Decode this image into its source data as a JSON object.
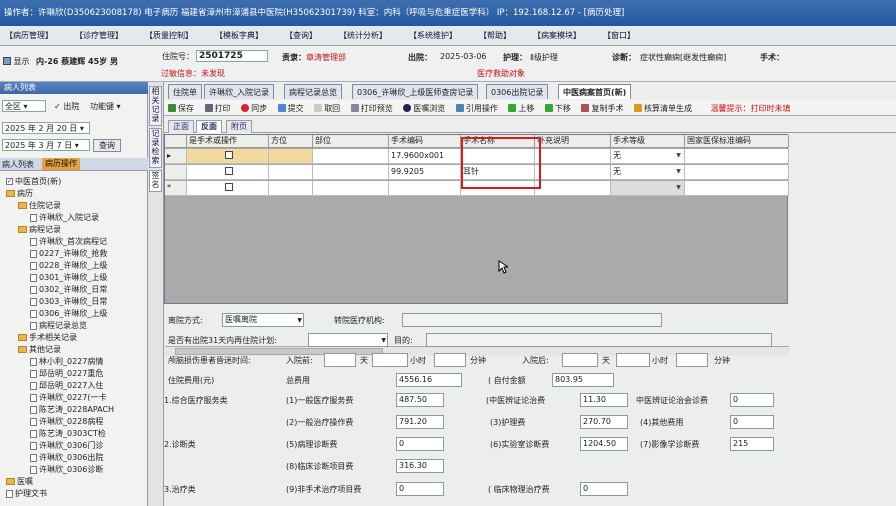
{
  "window_title": "操作者：许琳欣(D350623008178) 电子病历  福建省漳州市漳浦县中医院(H35062301739)  科室：内科（呼吸与危重症医学科） IP：192.168.12.67 - [病历处理]",
  "menu": [
    "【病历管理】",
    "【诊疗管理】",
    "【质量控制】",
    "【模板字典】",
    "【查询】",
    "【统计分析】",
    "【系统维护】",
    "【帮助】",
    "【病案模块】",
    "【窗口】"
  ],
  "patient": {
    "name_info": "内-26 蔡建辉 45岁 男",
    "show_label": "显示",
    "inpatient_label": "住院号：",
    "inpatient_no": "2501725",
    "duty_label": "责隶：",
    "duty": "章涛管理部",
    "qc_status": "过敏信息：未发现",
    "discharge_label": "出院：",
    "discharge_date": "2025-03-06",
    "nursing_label": "护理：",
    "nursing": "Ⅱ级护理",
    "diag_label": "诊断：",
    "diag": "症状性癫痫[继发性癫痫]",
    "expense_note": "医疗救助对象",
    "surgery_label": "手术："
  },
  "left_panel": {
    "title": "病人列表",
    "filter_all": "全区",
    "filter_discharged": "出院",
    "filter_function": "功能键",
    "date_from": "2025 年 2 月 20 日",
    "date_to": "2025 年 3 月 7 日",
    "query_btn": "查询",
    "tab_patients": "病人列表",
    "tab_records": "病历操作",
    "tree": [
      {
        "label": "中医首页(新)",
        "type": "check",
        "level": 0
      },
      {
        "label": "病历",
        "type": "folder",
        "level": 0
      },
      {
        "label": "住院记录",
        "type": "folder",
        "level": 1
      },
      {
        "label": "许琳欣_入院记录",
        "type": "doc",
        "level": 2
      },
      {
        "label": "病程记录",
        "type": "folder",
        "level": 1
      },
      {
        "label": "许琳欣_首次病程记",
        "type": "doc",
        "level": 2
      },
      {
        "label": "0227_许琳欣_抢救",
        "type": "doc",
        "level": 2
      },
      {
        "label": "0228_许琳欣_上级",
        "type": "doc",
        "level": 2
      },
      {
        "label": "0301_许琳欣_上级",
        "type": "doc",
        "level": 2
      },
      {
        "label": "0302_许琳欣_日常",
        "type": "doc",
        "level": 2
      },
      {
        "label": "0303_许琳欣_日常",
        "type": "doc",
        "level": 2
      },
      {
        "label": "0306_许琳欣_上级",
        "type": "doc",
        "level": 2
      },
      {
        "label": "病程记录总览",
        "type": "doc",
        "level": 2
      },
      {
        "label": "手术相关记录",
        "type": "folder",
        "level": 1
      },
      {
        "label": "其他记录",
        "type": "folder",
        "level": 1
      },
      {
        "label": "林小利_0227病情",
        "type": "doc",
        "level": 2
      },
      {
        "label": "邱岳明_0227重危",
        "type": "doc",
        "level": 2
      },
      {
        "label": "邱岳明_0227入住",
        "type": "doc",
        "level": 2
      },
      {
        "label": "许琳欣_0227(一卡",
        "type": "doc",
        "level": 2
      },
      {
        "label": "陈艺涛_0228APACH",
        "type": "doc",
        "level": 2
      },
      {
        "label": "许琳欣_0228病程",
        "type": "doc",
        "level": 2
      },
      {
        "label": "陈艺涛_0303CT检",
        "type": "doc",
        "level": 2
      },
      {
        "label": "许琳欣_0306门诊",
        "type": "doc",
        "level": 2
      },
      {
        "label": "许琳欣_0306出院",
        "type": "doc",
        "level": 2
      },
      {
        "label": "许琳欣_0306诊断",
        "type": "doc",
        "level": 2
      },
      {
        "label": "医嘱",
        "type": "folder",
        "level": 0
      },
      {
        "label": "护理文书",
        "type": "doc",
        "level": 0
      }
    ]
  },
  "vtabs": [
    "相关记录",
    "记录检索",
    "签名"
  ],
  "doc_tabs": [
    "住院单",
    "许琳欣_入院记录",
    "病程记录总览",
    "0306_许琳欣_上级医师查房记录",
    "0306出院记录",
    "中医病案首页(新)"
  ],
  "toolbar": [
    "保存",
    "打印",
    "同步",
    "提交",
    "取回",
    "打印预览",
    "医嘱浏览",
    "引用操作",
    "上移",
    "下移",
    "复制手术",
    "核算清单生成"
  ],
  "toolbar_tip": "温馨提示：打印时未填",
  "sub_tabs": [
    "正面",
    "反面",
    "附页"
  ],
  "grid": {
    "headers": [
      "是手术或操作",
      "方位",
      "部位",
      "手术编码",
      "手术名称",
      "补充说明",
      "手术等级",
      "国家医保标准编码"
    ],
    "rows": [
      {
        "code": "17.9600x001",
        "name": "",
        "level": "无"
      },
      {
        "code": "99.9205",
        "name": "耳针",
        "level": "无"
      },
      {
        "code": "",
        "name": "",
        "level": ""
      }
    ]
  },
  "form": {
    "discharge_mode_label": "离院方式:",
    "discharge_mode": "医嘱离院",
    "transfer_label": "转院医疗机构:",
    "readmit_label": "是否有出院31天内再住院计划:",
    "purpose_label": "目的:",
    "coma_label": "颅脑损伤患者昏迷时间:",
    "before_label": "入院前:",
    "after_label": "入院后:",
    "day": "天",
    "hour": "小时",
    "minute": "分钟",
    "cost_title": "住院费用(元)",
    "total_label": "总费用",
    "total": "4556.16",
    "self_pay_label": "(   自付金额",
    "self_pay": "803.95",
    "sec1": "1.综合医疗服务类",
    "sec2": "2.诊断类",
    "sec3": "3.治疗类",
    "f1_label": "(1)一般医疗服务费",
    "f1": "487.50",
    "f1b_label": "(中医辨证论治费",
    "f1b": "11.30",
    "f1c_label": "中医辨证论治会诊费",
    "f1c": "0",
    "f2_label": "(2)一般治疗操作费",
    "f2": "791.20",
    "f3_label": "(3)护理费",
    "f3": "270.70",
    "f4_label": "(4)其他费用",
    "f4": "0",
    "f5_label": "(5)病理诊断费",
    "f5": "0",
    "f6_label": "(6)实验室诊断费",
    "f6": "1204.50",
    "f7_label": "(7)影像学诊断费",
    "f7": "215",
    "f8_label": "(8)临床诊断项目费",
    "f8": "316.30",
    "f9_label": "(9)非手术治疗项目费",
    "f9": "0",
    "f9b_label": "(   临床物理治疗费",
    "f9b": "0"
  }
}
